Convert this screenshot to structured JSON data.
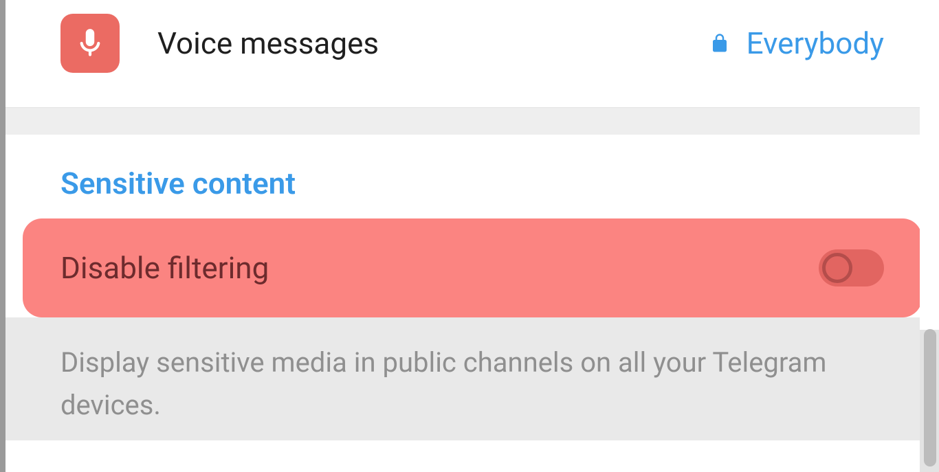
{
  "voice_messages": {
    "label": "Voice messages",
    "value": "Everybody"
  },
  "sensitive_content": {
    "section_title": "Sensitive content",
    "toggle_label": "Disable filtering",
    "toggle_state": false,
    "description": "Display sensitive media in public channels on all your Telegram devices."
  },
  "colors": {
    "accent_blue": "#3a9ae8",
    "icon_red": "#eb6b63",
    "highlight_red": "#fb8481"
  }
}
